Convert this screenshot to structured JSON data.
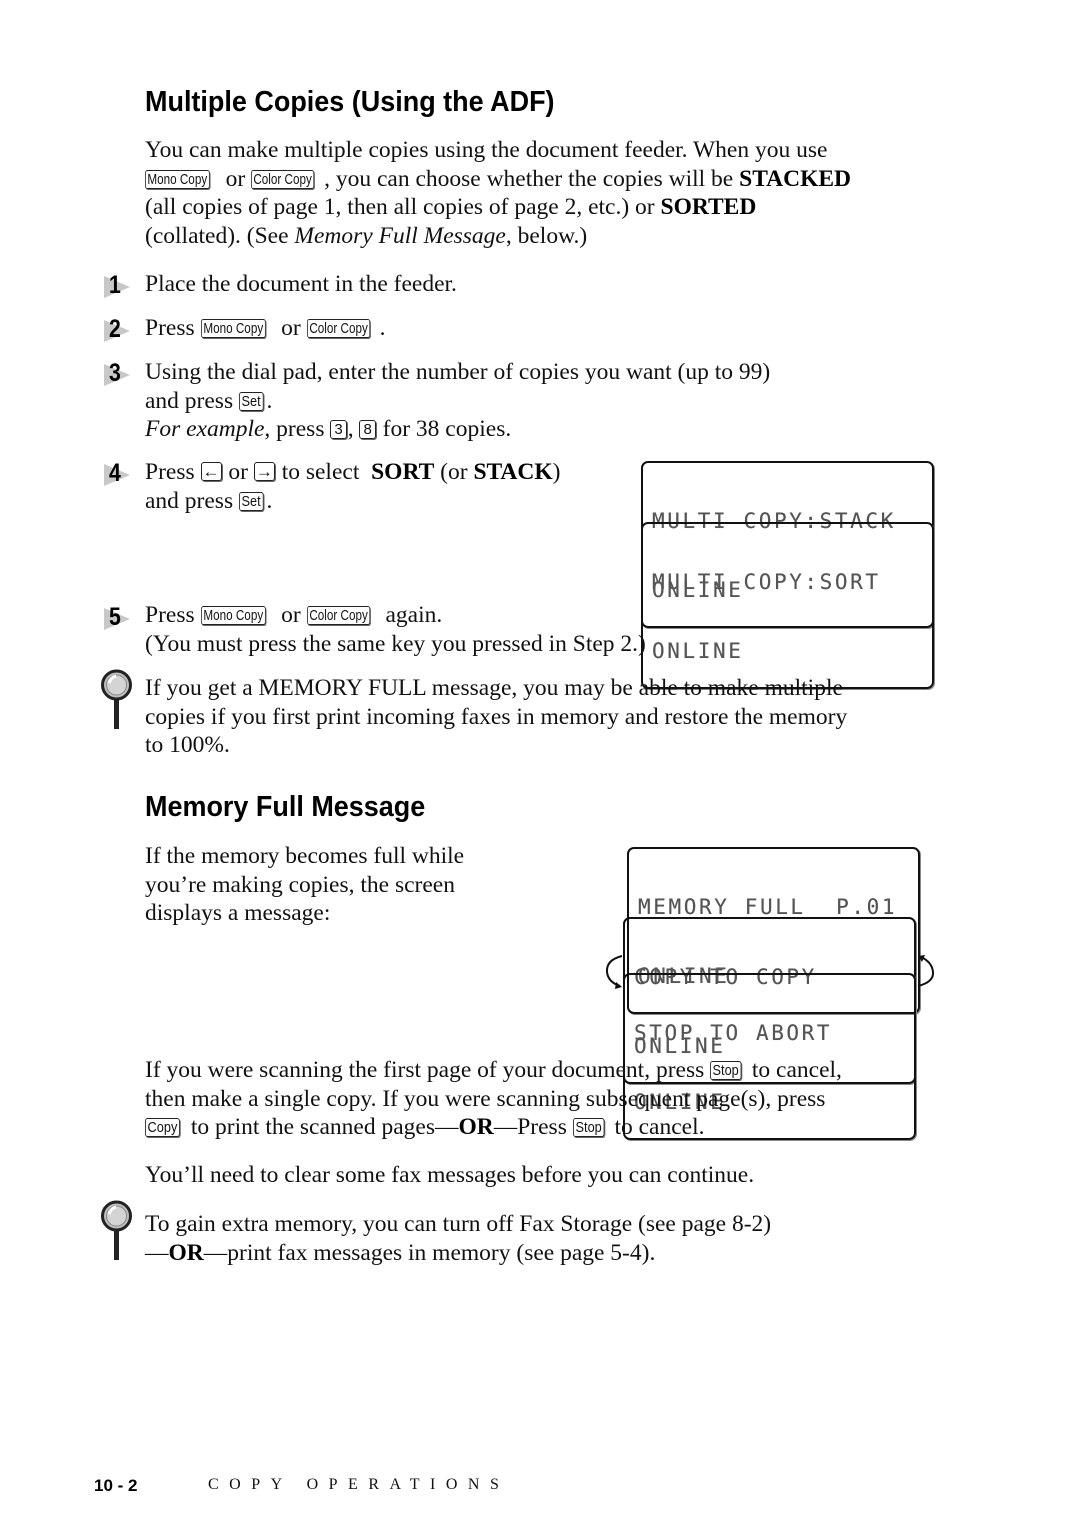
{
  "section1": {
    "title": "Multiple Copies (Using the ADF)",
    "intro": {
      "t1": "You can make multiple copies using the document feeder. When you use",
      "key_mono": "Mono Copy",
      "or": "or",
      "key_color": "Color Copy",
      "t2": ", you can choose whether the copies will be ",
      "stacked": "STACKED",
      "t3": "(all copies of page 1, then all copies of page 2, etc.) or ",
      "sorted": "SORTED",
      "t4": "(collated). (See ",
      "ref": "Memory Full Message",
      "t5": ", below.)"
    },
    "steps": [
      {
        "num": "1",
        "text": "Place the document in the feeder."
      },
      {
        "num": "2",
        "t1": "Press ",
        "key1": "Mono Copy",
        "or": " or ",
        "key2": "Color Copy",
        "end": "."
      },
      {
        "num": "3",
        "t1": "Using the dial pad, enter the number of copies you want (up to 99)",
        "t2": "and press ",
        "key_set": "Set",
        "end": ".",
        "ex_italic": "For example",
        "ex_t1": ", press ",
        "key_3": "3",
        "ex_comma": ", ",
        "key_8": "8",
        "ex_t2": " for 38 copies."
      },
      {
        "num": "4",
        "t1": "Press ",
        "key_left": "←",
        "or": " or ",
        "key_right": "→",
        "t2": " to select  ",
        "sort": "SORT",
        "t3": " (or ",
        "stack": "STACK",
        "t4": ")",
        "t5": "and press ",
        "key_set": "Set",
        "end": "."
      },
      {
        "num": "5",
        "t1": "Press ",
        "key1": "Mono Copy",
        "or": " or ",
        "key2": "Color Copy",
        "t2": " again.",
        "t3": "(You must press the same key you pressed in Step 2.)"
      }
    ],
    "lcd_stack": {
      "line1": "MULTI COPY:STACK",
      "line2": "ONLINE"
    },
    "lcd_sort": {
      "line1": "MULTI COPY:SORT",
      "line2": "ONLINE"
    },
    "note": {
      "l1": "If you get a MEMORY FULL message, you may be able to make multiple",
      "l2": "copies if you first print incoming faxes in memory and restore the memory",
      "l3": "to 100%."
    }
  },
  "section2": {
    "title": "Memory Full Message",
    "intro": {
      "l1": "If the memory becomes full while",
      "l2": "you’re making copies, the screen",
      "l3": "displays a message:"
    },
    "lcd_full": {
      "line1": "MEMORY FULL  P.01",
      "line2": "ONLINE"
    },
    "lcd_copy": {
      "line1": "COPY TO COPY",
      "line2": "ONLINE"
    },
    "lcd_abort": {
      "line1": "STOP TO ABORT",
      "line2": "ONLINE"
    },
    "para1": {
      "t1": "If you were scanning the first page of your document, press ",
      "key_stop": "Stop",
      "t2": " to cancel,",
      "t3": "then make a single copy. If you were scanning subsequent page(s), press",
      "key_copy": "Copy",
      "t4": " to print the scanned pages—",
      "or": "OR",
      "t5": "—Press ",
      "t6": " to cancel."
    },
    "para2": "You’ll need to clear some fax messages before you can continue.",
    "note": {
      "l1": "To gain extra memory, you can turn off Fax Storage (see page 8-2)",
      "dash1": "—",
      "or": "OR",
      "l2": "—print fax messages in memory (see page 5-4)."
    }
  },
  "footer": {
    "page_number": "10 - 2",
    "chapter": "COPY OPERATIONS"
  }
}
